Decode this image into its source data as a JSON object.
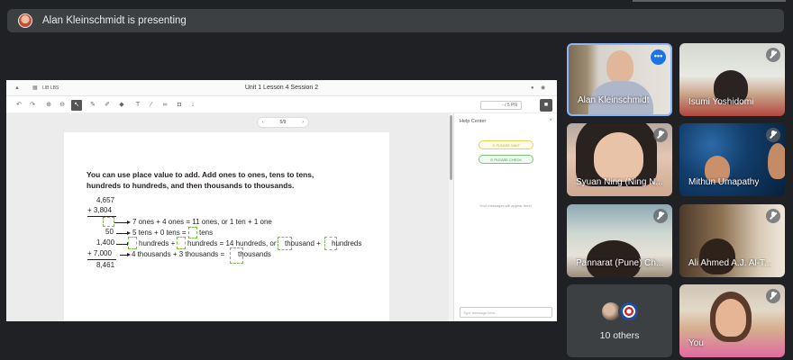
{
  "banner": {
    "text": "Alan Kleinschmidt is presenting"
  },
  "presentation": {
    "title": "Unit 1 Lesson 4 Session 2",
    "top_left_label": "LIB LBS",
    "pager": {
      "prev": "‹",
      "page": "5/9",
      "next": "›"
    },
    "zoom": "- / 5 PN",
    "page_content": {
      "heading_line1": "You can use place value to add. Add ones to ones, tens to tens,",
      "heading_line2": "hundreds to hundreds, and then thousands to thousands.",
      "n1": "4,657",
      "n2": "+ 3,804",
      "r1_val": "",
      "r1_text": "7 ones + 4 ones = 11 ones, or 1 ten + 1 one",
      "r2_val": "50",
      "r2_text": "5 tens + 0 tens =",
      "r2_end": "tens",
      "r3_val": "1,400",
      "r3_a": "hundreds +",
      "r3_b": "hundreds = 14 hundreds, or",
      "r3_c": "thousand +",
      "r3_d": "hundreds",
      "r4_val": "+ 7,000",
      "r4_text": "4 thousands + 3 thousands =",
      "r4_end": "thousands",
      "total": "8,461"
    }
  },
  "help_center": {
    "title": "Help Center",
    "close": "×",
    "please_wait": "⊙ PLEASE WAIT",
    "please_check": "⊙ PLEASE CHECK",
    "empty_message": "Your messages will appear here!",
    "input_placeholder": "Type message here..."
  },
  "participants": [
    {
      "name": "Alan Kleinschmidt",
      "more": "•••"
    },
    {
      "name": "Isumi Yoshidomi"
    },
    {
      "name": "Syuan Ning (Ning N..."
    },
    {
      "name": "Mithun Umapathy"
    },
    {
      "name": "Pannarat (Pune) Ch..."
    },
    {
      "name": "Ali Ahmed A.J. Al-T..."
    },
    {
      "name": "10 others"
    },
    {
      "name": "You"
    }
  ],
  "colors": {
    "active_border": "#8ab4f8",
    "more_button": "#1a73e8",
    "dashed_box": "#77c043"
  }
}
